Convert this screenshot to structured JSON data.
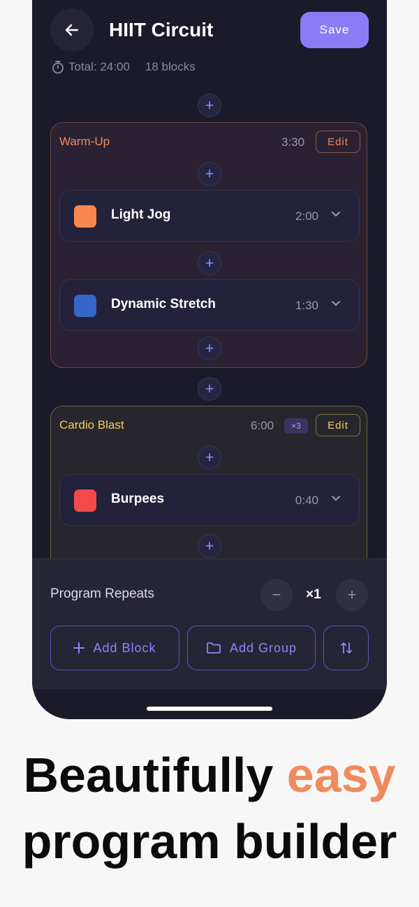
{
  "header": {
    "title": "HIIT Circuit",
    "save_label": "Save",
    "total_text": "Total: 24:00",
    "blocks_text": "18 blocks"
  },
  "groups": [
    {
      "name": "Warm-Up",
      "time": "3:30",
      "edit_label": "Edit",
      "color": "#f18a5c",
      "blocks": [
        {
          "name": "Light Jog",
          "time": "2:00",
          "color": "#f7874f"
        },
        {
          "name": "Dynamic Stretch",
          "time": "1:30",
          "color": "#3566c8"
        }
      ]
    },
    {
      "name": "Cardio Blast",
      "time": "6:00",
      "repeat_badge": "×3",
      "edit_label": "Edit",
      "color": "#f0d060",
      "blocks": [
        {
          "name": "Burpees",
          "time": "0:40",
          "color": "#f24a4a"
        }
      ]
    }
  ],
  "footer": {
    "repeat_label": "Program Repeats",
    "repeat_value": "×1",
    "add_block_label": "Add Block",
    "add_group_label": "Add Group"
  },
  "headline": {
    "line1_prefix": "Beautifully",
    "line1_accent": "easy",
    "line2": "program builder"
  },
  "colors": {
    "accent": "#8b7cf5",
    "orange": "#f18a5c",
    "background": "#1b1a2a"
  }
}
